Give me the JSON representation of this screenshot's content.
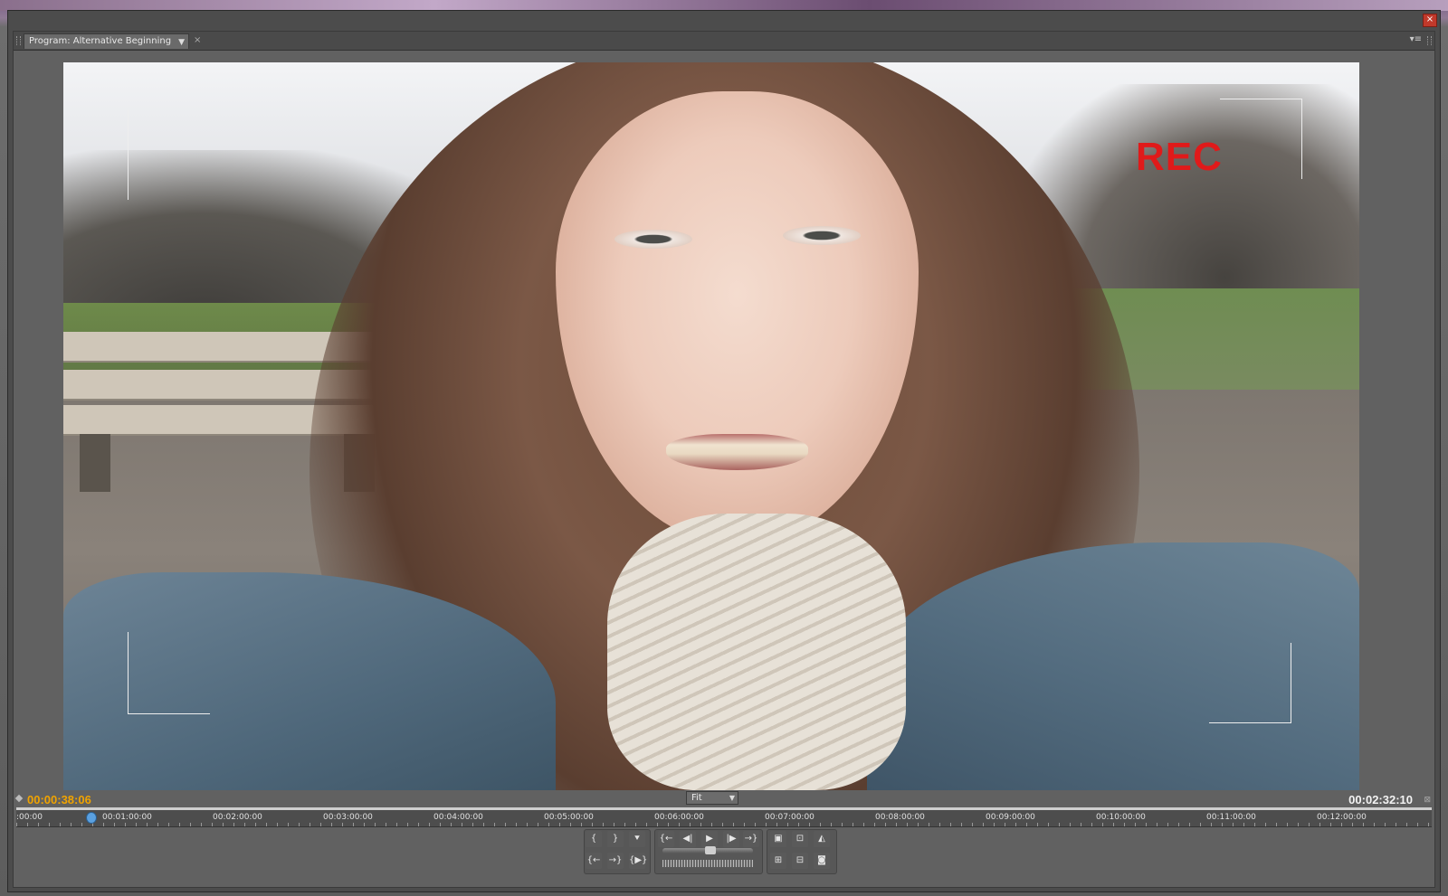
{
  "panel": {
    "tab_label": "Program: Alternative Beginning",
    "tab_dropdown_icon": "chevron-down-icon",
    "tab_close": "×",
    "menu_icon": "panel-menu-icon",
    "close_window": "×"
  },
  "video": {
    "overlay_text": "REC",
    "overlay_color": "#e01a1a"
  },
  "transport": {
    "current_timecode": "00:00:38:06",
    "duration_timecode": "00:02:32:10",
    "zoom_value": "Fit",
    "accent_color": "#f0a300"
  },
  "ruler": {
    "labels": [
      ":00:00",
      "00:01:00:00",
      "00:02:00:00",
      "00:03:00:00",
      "00:04:00:00",
      "00:05:00:00",
      "00:06:00:00",
      "00:07:00:00",
      "00:08:00:00",
      "00:09:00:00",
      "00:10:00:00",
      "00:11:00:00",
      "00:12:00:00"
    ]
  },
  "controls": {
    "mark_in": "{",
    "mark_out": "}",
    "add_marker": "⯆",
    "go_to_in": "{←",
    "step_back": "◀|",
    "play": "▶",
    "step_forward": "|▶",
    "go_to_out": "→}",
    "go_to_prev_edit": "{←",
    "go_to_next_edit": "→}",
    "play_in_to_out": "{▶}",
    "lift": "▣",
    "extract": "▦",
    "export_frame": "◙",
    "safe_margins": "⊡",
    "output": "◭",
    "insert": "⊞",
    "overlay": "⊟"
  }
}
